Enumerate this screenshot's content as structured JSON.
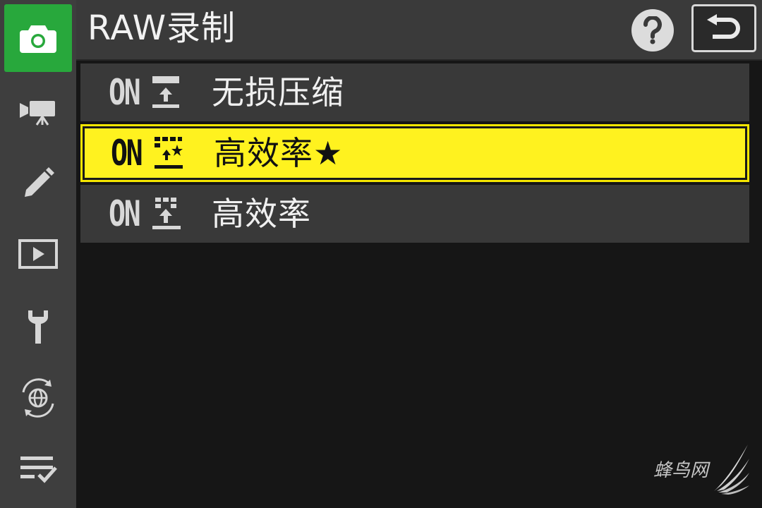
{
  "header": {
    "title": "RAW录制",
    "help_icon": "help-icon",
    "back_icon": "return-icon"
  },
  "sidebar": {
    "items": [
      {
        "icon": "camera-icon",
        "active": true
      },
      {
        "icon": "movie-camera-icon",
        "active": false
      },
      {
        "icon": "pencil-icon",
        "active": false
      },
      {
        "icon": "playback-icon",
        "active": false
      },
      {
        "icon": "wrench-icon",
        "active": false
      },
      {
        "icon": "network-globe-icon",
        "active": false
      },
      {
        "icon": "my-menu-icon",
        "active": false
      }
    ]
  },
  "menu": {
    "options": [
      {
        "on": "ON",
        "label": "无损压缩",
        "icon": "lossless-compression-icon",
        "selected": false
      },
      {
        "on": "ON",
        "label": "高效率★",
        "icon": "high-efficiency-star-icon",
        "selected": true
      },
      {
        "on": "ON",
        "label": "高效率",
        "icon": "high-efficiency-icon",
        "selected": false
      }
    ]
  },
  "watermark": {
    "text": "蜂鸟网"
  },
  "colors": {
    "accent_green": "#28a83c",
    "highlight_yellow": "#fff21f",
    "sidebar_bg": "#3e3e3e",
    "row_bg": "#393939",
    "page_bg": "#161616"
  }
}
